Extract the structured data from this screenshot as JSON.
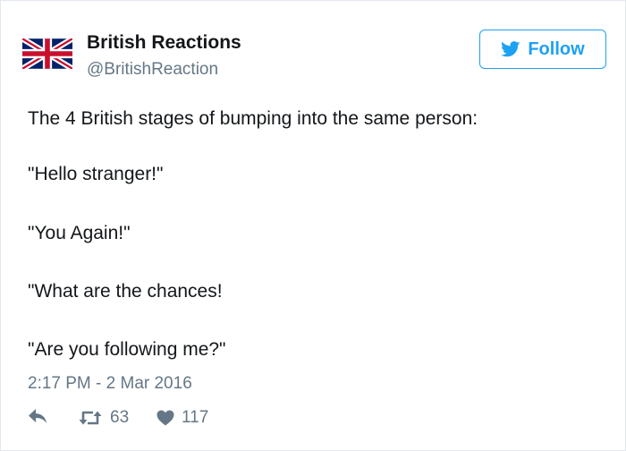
{
  "account": {
    "name": "British Reactions",
    "handle": "@BritishReaction",
    "avatar_icon": "union-jack-flag"
  },
  "follow_button": {
    "label": "Follow",
    "icon": "twitter-bird-icon",
    "color": "#1da1f2"
  },
  "tweet": {
    "lines": [
      "The 4 British stages of bumping into the same person:",
      "\"Hello stranger!\"",
      "\"You Again!\"",
      "\"What are the chances!",
      "\"Are you following me?\""
    ],
    "timestamp": "2:17 PM - 2 Mar 2016"
  },
  "actions": {
    "reply_icon": "reply-icon",
    "retweet_icon": "retweet-icon",
    "retweet_count": "63",
    "like_icon": "heart-icon",
    "like_count": "117"
  }
}
